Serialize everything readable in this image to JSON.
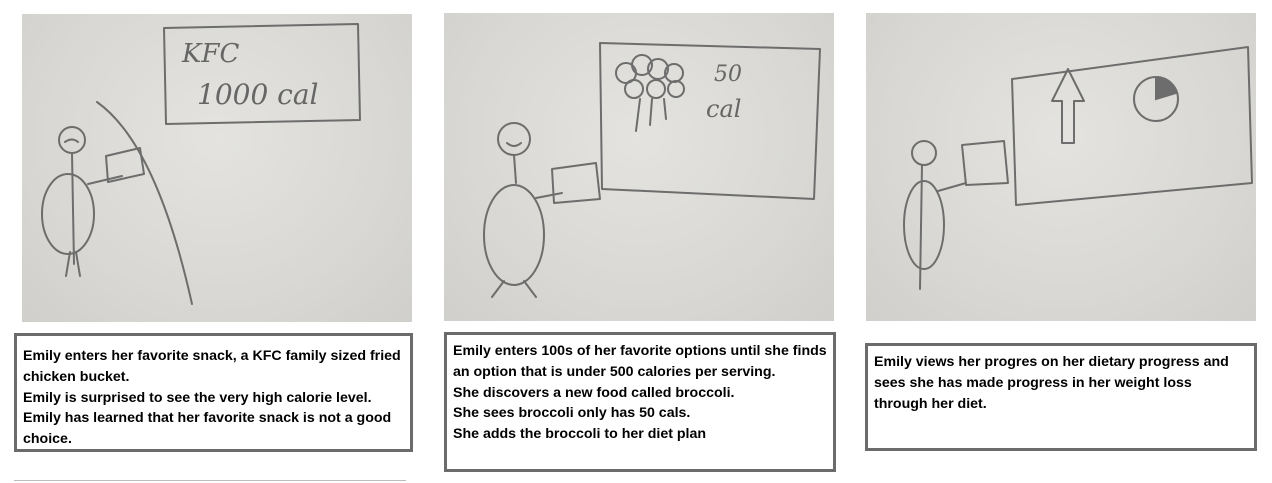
{
  "panels": [
    {
      "sketch_text": [
        "KFC",
        "1000 cal"
      ],
      "caption_lines": [
        "Emily enters her favorite snack, a KFC family sized fried chicken bucket.",
        "Emily is surprised to see the very high calorie level.",
        "Emily has learned that her favorite snack is not a good choice."
      ]
    },
    {
      "sketch_text": [
        "50",
        "cal"
      ],
      "caption_lines": [
        "Emily enters 100s of her favorite options until she finds an option that is under 500 calories per serving.",
        "She discovers a new food called broccoli.",
        "She sees broccoli only has 50 cals.",
        "She adds the broccoli to her diet plan"
      ]
    },
    {
      "sketch_text": [],
      "caption_lines": [
        "Emily views her progres on her dietary progress and sees she has made progress in her weight loss through her diet."
      ]
    }
  ]
}
